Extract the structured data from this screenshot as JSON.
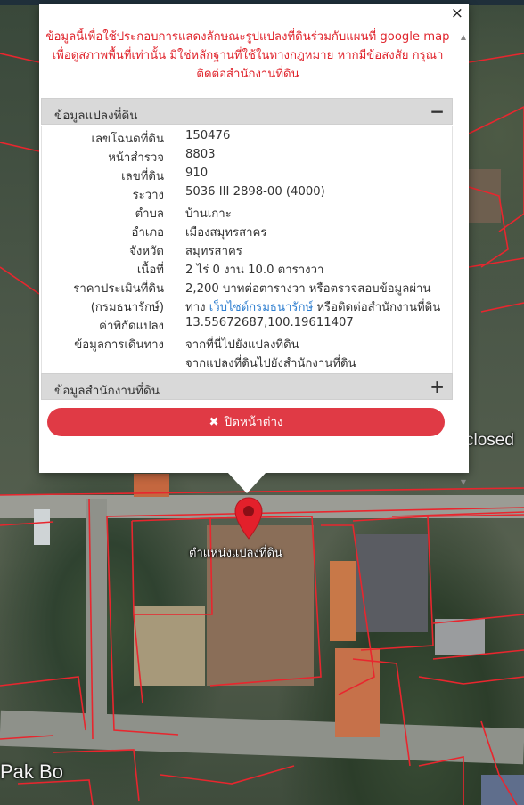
{
  "popup": {
    "close_glyph": "×",
    "disclaimer": [
      "ข้อมูลนี้เพื่อใช้ประกอบการแสดงลักษณะรูปแปลงที่ดินร่วมกับแผนที่ google map",
      "เพื่อดูสภาพพื้นที่เท่านั้น มิใช่หลักฐานที่ใช้ในทางกฎหมาย หากมีข้อสงสัย กรุณา",
      "ติดต่อสำนักงานที่ดิน"
    ],
    "land_panel": {
      "title": "ข้อมูลแปลงที่ดิน",
      "toggle": "−",
      "rows": [
        {
          "label": "เลขโฉนดที่ดิน",
          "value": "150476"
        },
        {
          "label": "หน้าสำรวจ",
          "value": "8803"
        },
        {
          "label": "เลขที่ดิน",
          "value": "910"
        },
        {
          "label": "ระวาง",
          "value": "5036 III 2898-00 (4000)"
        },
        {
          "label": "ตำบล",
          "value": "บ้านเกาะ"
        },
        {
          "label": "อำเภอ",
          "value": "เมืองสมุทรสาคร"
        },
        {
          "label": "จังหวัด",
          "value": "สมุทรสาคร"
        },
        {
          "label": "เนื้อที่",
          "value": "2 ไร่ 0 งาน 10.0 ตารางวา"
        },
        {
          "label": "ราคาประเมินที่ดิน",
          "value": "2,200 บาทต่อตารางวา หรือตรวจสอบข้อมูลผ่าน"
        },
        {
          "label": "(กรมธนารักษ์)",
          "value_prefix": "ทาง ",
          "value_link": "เว็บไซต์กรมธนารักษ์",
          "value_suffix": " หรือติดต่อสำนักงานที่ดิน"
        },
        {
          "label": "ค่าพิกัดแปลง",
          "value_link": "13.55672687,100.19611407"
        },
        {
          "label": "ข้อมูลการเดินทาง",
          "value_link": "จากที่นี่ไปยังแปลงที่ดิน"
        },
        {
          "label": "",
          "value_link": "จากแปลงที่ดินไปยังสำนักงานที่ดิน"
        }
      ]
    },
    "office_panel": {
      "title": "ข้อมูลสำนักงานที่ดิน",
      "toggle": "+"
    },
    "close_button": {
      "icon": "✖",
      "label": "ปิดหน้าต่าง"
    }
  },
  "map": {
    "marker_label": "ตำแหน่งแปลงที่ดิน",
    "place_labels": {
      "closed": "closed",
      "pak_bo": "Pak Bo"
    },
    "parcel_line_color": "#e8262e",
    "link_color": "#2f7fd0",
    "button_color": "#e03a45"
  }
}
